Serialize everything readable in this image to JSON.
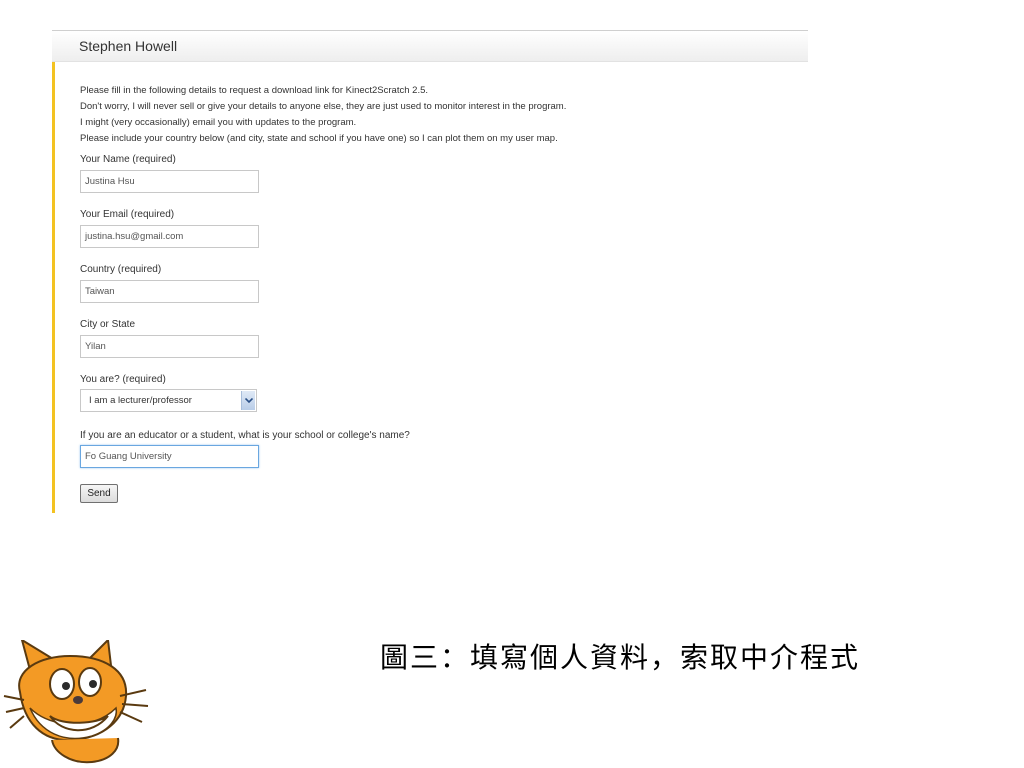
{
  "header": {
    "title": "Stephen Howell"
  },
  "intro": {
    "lines": [
      "Please fill in the following details to request a download link for Kinect2Scratch 2.5.",
      "Don't worry, I will never sell or give your details to anyone else, they are just used to monitor interest in the program.",
      "I might (very occasionally) email you with updates to the program.",
      "Please include your country below (and city, state and school if you have one) so I can plot them on my user map."
    ]
  },
  "form": {
    "name": {
      "label": "Your Name (required)",
      "value": "Justina Hsu"
    },
    "email": {
      "label": "Your Email (required)",
      "value": "justina.hsu@gmail.com"
    },
    "country": {
      "label": "Country (required)",
      "value": "Taiwan"
    },
    "city": {
      "label": "City or State",
      "value": "Yilan"
    },
    "role": {
      "label": "You are? (required)",
      "selected": "I am a lecturer/professor"
    },
    "school": {
      "label": "If you are an educator or a student, what is your school or college's name?",
      "value": "Fo Guang University"
    },
    "send_label": "Send"
  },
  "caption": "圖三：填寫個人資料，索取中介程式",
  "colors": {
    "accent_bar": "#f3c221",
    "focus_border": "#6aa7e0",
    "mascot_orange": "#f39a25"
  },
  "icons": {
    "select_arrow": "chevron-down-icon",
    "mascot": "scratch-cat-icon"
  }
}
